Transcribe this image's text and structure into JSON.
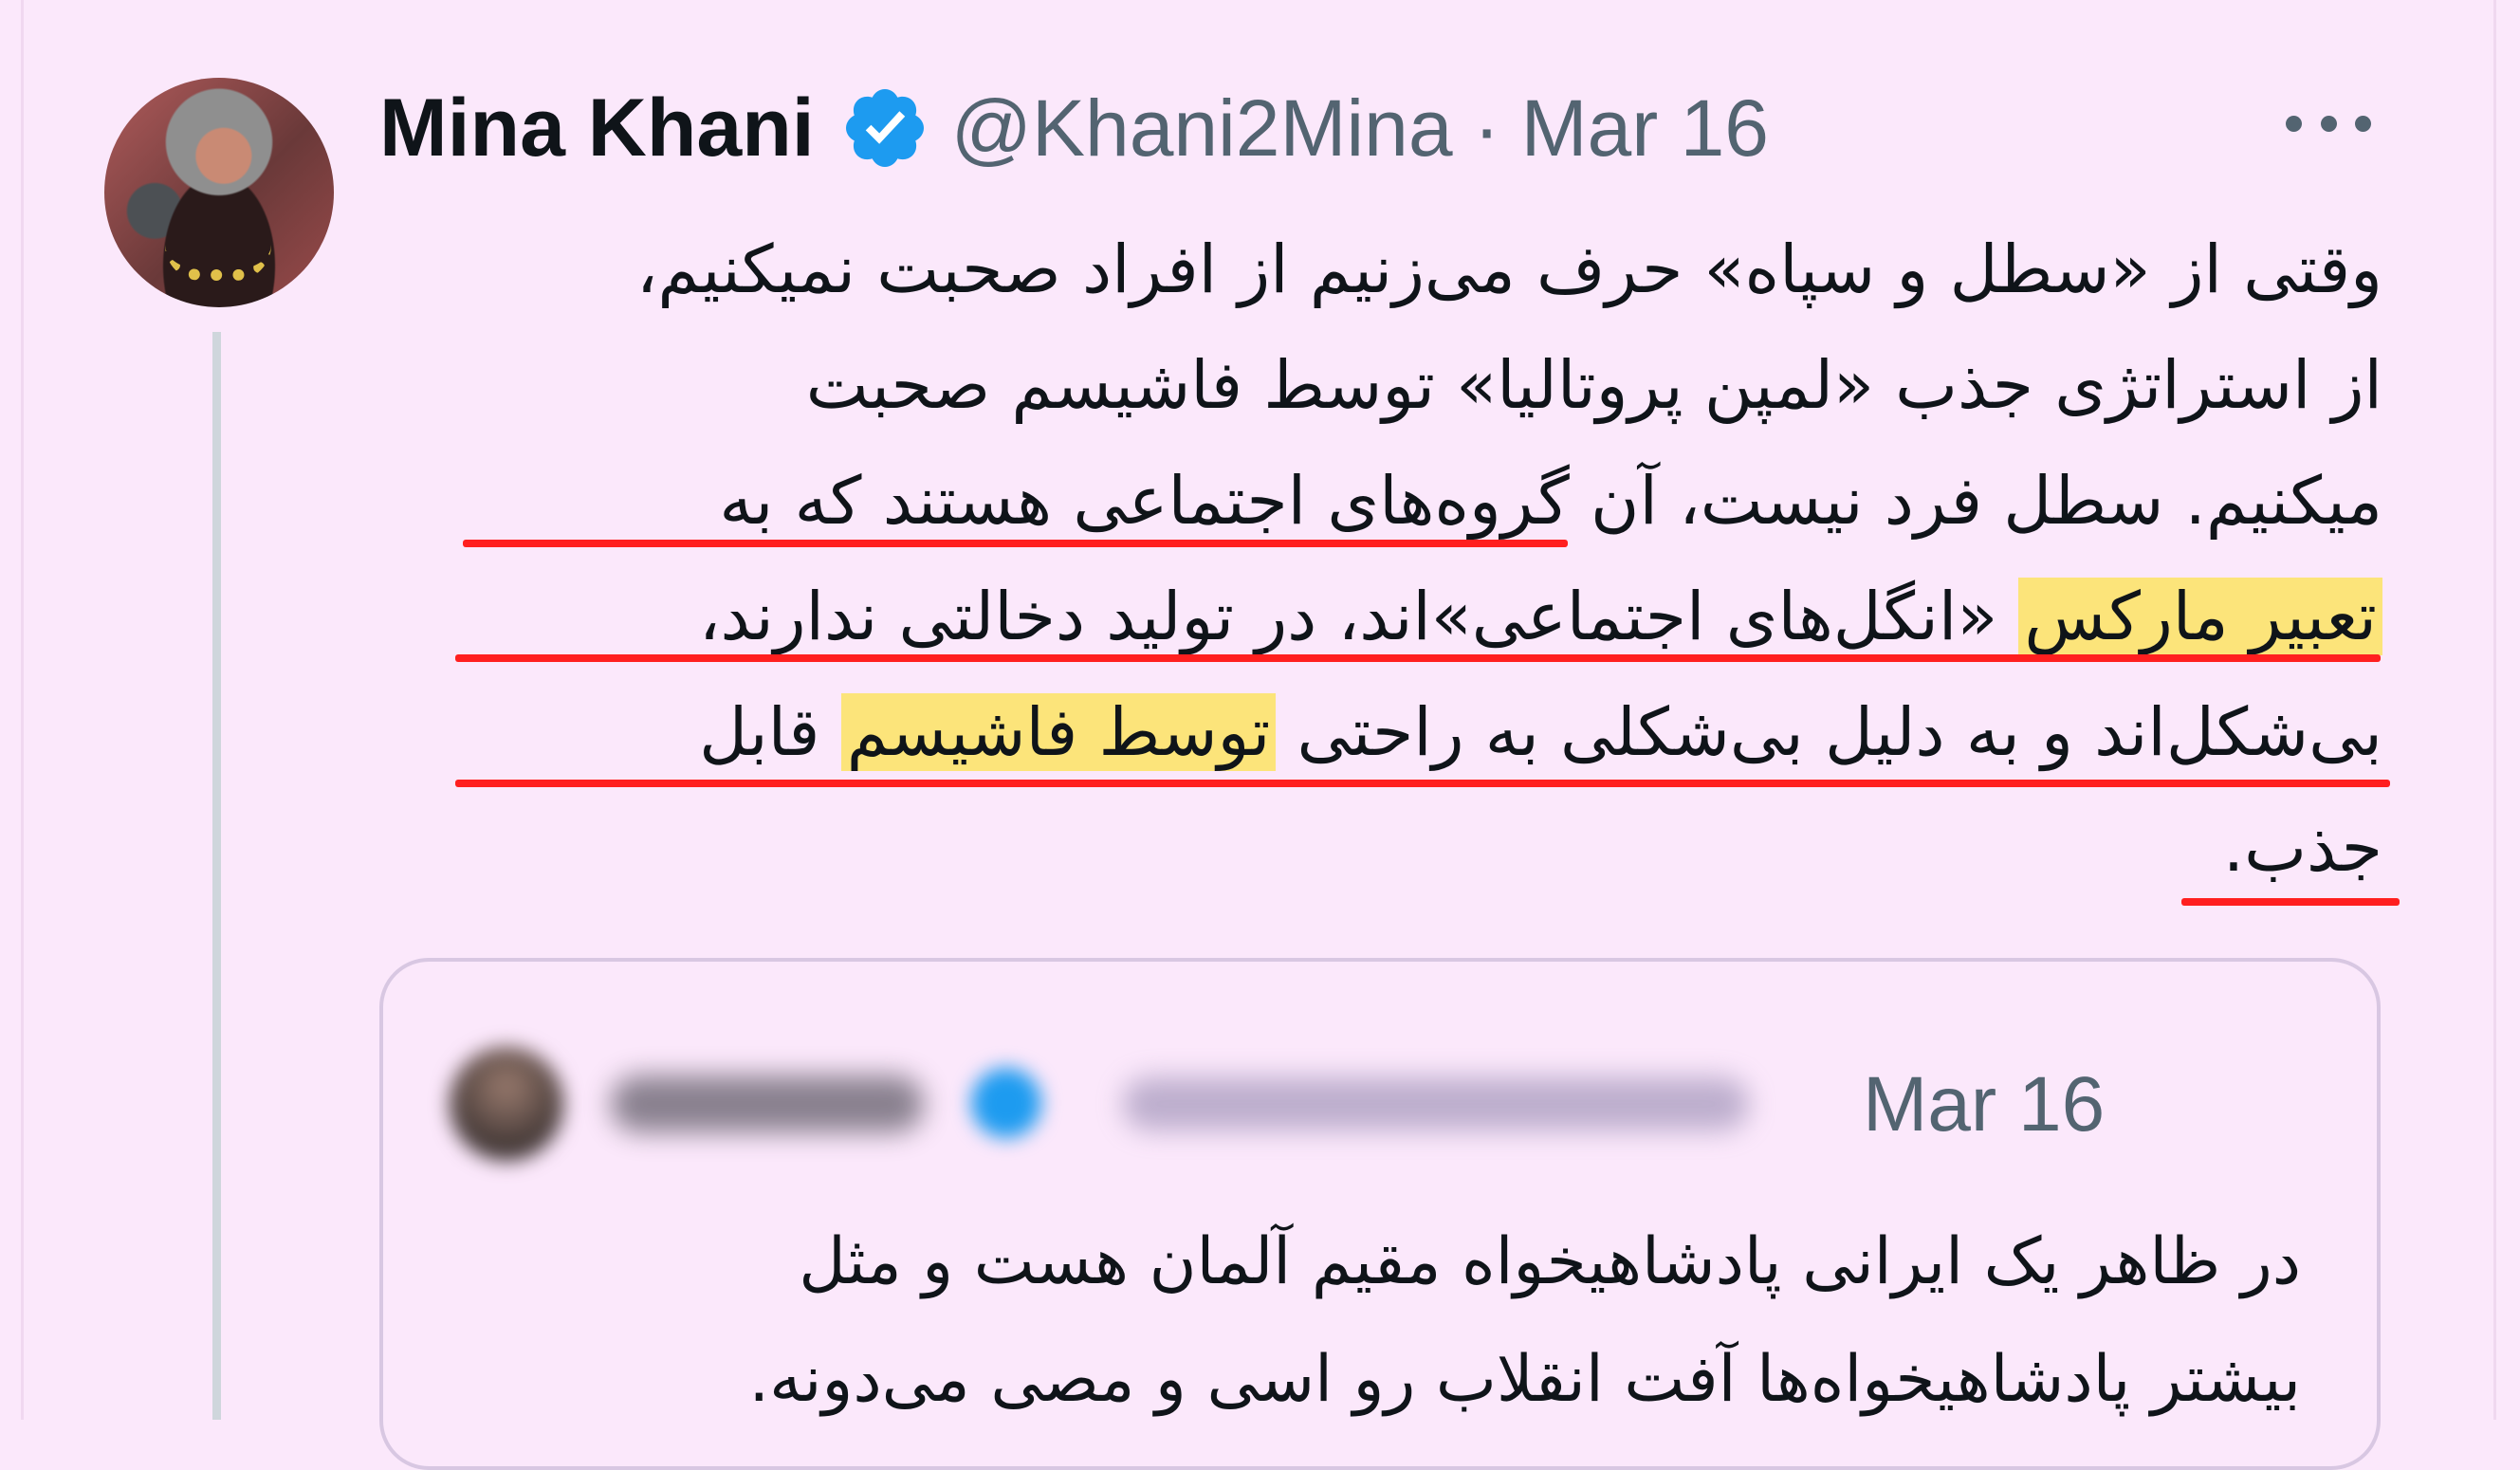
{
  "tweet": {
    "author_name": "Mina Khani",
    "handle": "@Khani2Mina",
    "separator": "·",
    "date": "Mar 16",
    "verified": true,
    "more_icon": "more-horizontal-icon",
    "text_line1": "وقتی از «سطل و سپاه» حرف می‌زنیم از افراد صحبت نمیکنیم،",
    "text_line2": "از استراتژی جذب «لمپن پروتالیا» توسط فاشیسم صحبت",
    "text_line3": "میکنیم. سطل فرد نیست، آن گروه‌های اجتماعی هستند که به",
    "text_line4_hl": "تعبیر مارکس",
    "text_line4_rest": " «انگل‌های اجتماعی»اند، در تولید دخالتی ندارند،",
    "text_line5_start": "بی‌شکل‌اند و به دلیل بی‌شکلی به راحتی ",
    "text_line5_hl": "توسط فاشیسم",
    "text_line5_end": " قابل",
    "text_line6": "جذب."
  },
  "quoted_tweet": {
    "date": "Mar 16",
    "text_line1": "در ظاهر یک ایرانی پادشاهیخواه مقیم آلمان هست و مثل",
    "text_line2": "بیشتر پادشاهیخواه‌ها آفت انقلاب رو اسی و مصی می‌دونه."
  },
  "colors": {
    "background": "#fbe8fb",
    "highlight": "#fce47a",
    "underline": "#ff1f1f",
    "verified_badge": "#1d9bf0",
    "secondary_text": "#536471"
  }
}
